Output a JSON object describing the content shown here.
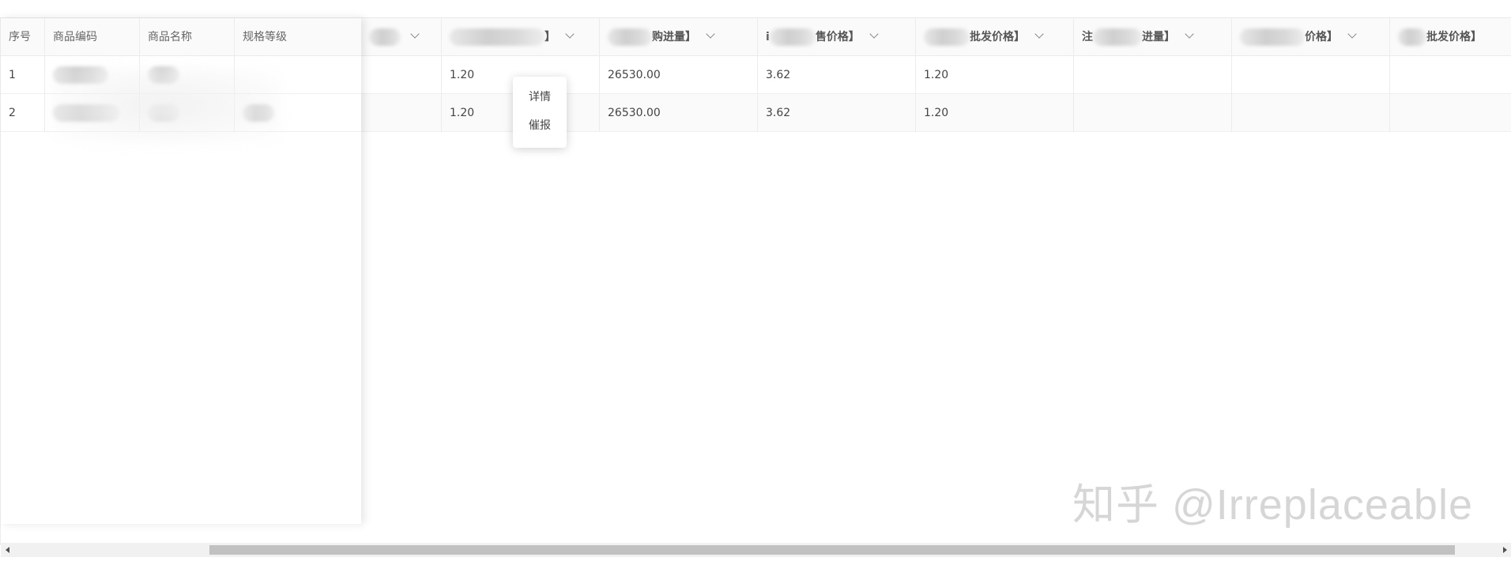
{
  "fixed_headers": [
    "序号",
    "商品编码",
    "商品名称",
    "规格等级"
  ],
  "rows": [
    {
      "index": "1",
      "c1": "1.20",
      "c2": "26530.00",
      "c3": "3.62",
      "c4": "1.20"
    },
    {
      "index": "2",
      "c1": "1.20",
      "c2": "26530.00",
      "c3": "3.62",
      "c4": "1.20"
    }
  ],
  "scroll_headers": {
    "h2": "】",
    "h3": "购进量】",
    "h4_prefix": "i",
    "h4": "售价格】",
    "h5": "批发价格】",
    "h6_prefix": "注",
    "h6": "进量】",
    "h7": "价格】",
    "h8": "批发价格】"
  },
  "popup": {
    "items": [
      "详情",
      "催报"
    ]
  },
  "watermark": "知乎 @Irreplaceable"
}
